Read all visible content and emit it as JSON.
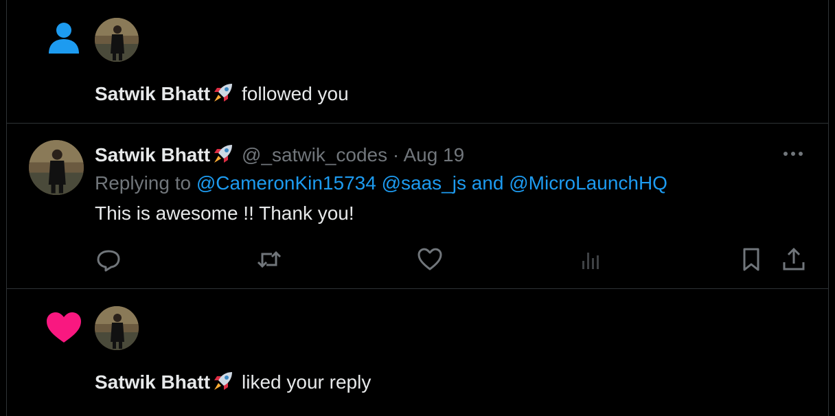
{
  "notifications": [
    {
      "type": "follow",
      "type_icon": "person-icon",
      "user_name": "Satwik Bhatt",
      "name_emoji": "rocket-emoji",
      "action": "followed you"
    },
    {
      "type": "reply",
      "user_name": "Satwik Bhatt",
      "name_emoji": "rocket-emoji",
      "handle": "@_satwik_codes",
      "separator": "·",
      "date": "Aug 19",
      "replying_prefix": "Replying to",
      "mention_1": "@CameronKin15734",
      "mention_2": "@saas_js",
      "and_word": "and",
      "mention_3": "@MicroLaunchHQ",
      "text": "This is awesome !! Thank you!",
      "more_icon": "more-horizontal-icon",
      "actions": [
        "reply-icon",
        "retweet-icon",
        "like-icon",
        "analytics-icon",
        "bookmark-icon",
        "share-icon"
      ]
    },
    {
      "type": "like",
      "type_icon": "heart-icon",
      "user_name": "Satwik Bhatt",
      "name_emoji": "rocket-emoji",
      "action": "liked your reply"
    }
  ],
  "colors": {
    "background": "#000000",
    "text": "#e7e9ea",
    "muted": "#71767b",
    "accent": "#1d9bf0",
    "heart": "#f91880",
    "divider": "#2f3336"
  }
}
